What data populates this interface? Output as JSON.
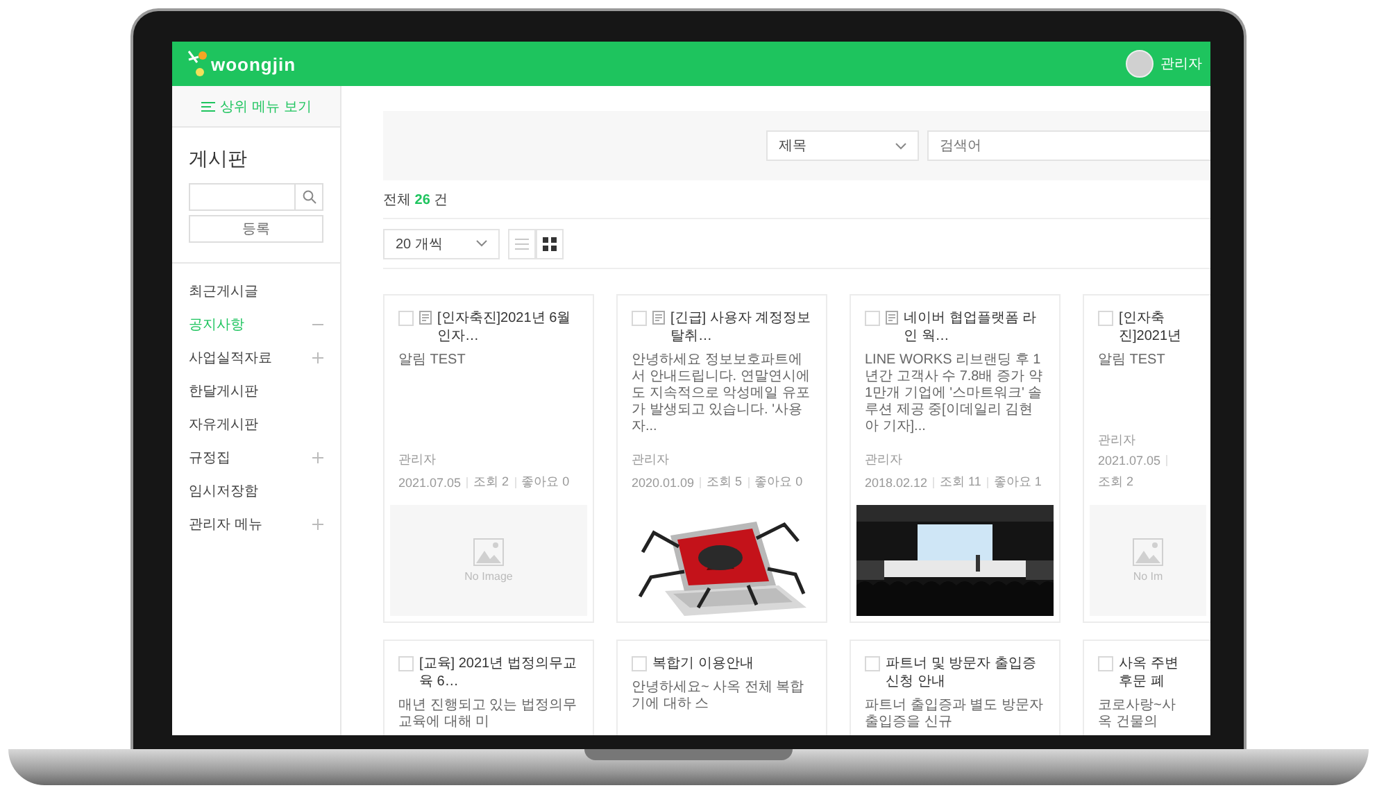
{
  "header": {
    "logo": "woongjin",
    "user": "관리자"
  },
  "sidebar": {
    "top_menu": "상위 메뉴 보기",
    "title": "게시판",
    "register": "등록",
    "items": [
      {
        "kind": "link",
        "label": "최근게시글",
        "selected": false
      },
      {
        "kind": "group",
        "label": "공지사항",
        "selected": true,
        "expanded": true
      },
      {
        "kind": "group",
        "label": "사업실적자료",
        "selected": false,
        "expanded": false
      },
      {
        "kind": "link",
        "label": "한달게시판",
        "selected": false
      },
      {
        "kind": "link",
        "label": "자유게시판",
        "selected": false
      },
      {
        "kind": "group",
        "label": "규정집",
        "selected": false,
        "expanded": false
      },
      {
        "kind": "link",
        "label": "임시저장함",
        "selected": false
      },
      {
        "kind": "group",
        "label": "관리자 메뉴",
        "selected": false,
        "expanded": false
      }
    ]
  },
  "search_panel": {
    "field": "제목",
    "placeholder": "검색어"
  },
  "total": {
    "prefix": "전체",
    "count": "26",
    "suffix": "건"
  },
  "toolbar": {
    "page_size": "20 개씩",
    "views": [
      {
        "kind": "list",
        "selected": false
      },
      {
        "kind": "grid",
        "selected": true
      }
    ]
  },
  "cards": [
    {
      "cut": false,
      "checked": false,
      "file": true,
      "title": "[인자축진]2021년 6월 인자…",
      "excerpt": "알림 TEST",
      "author": "관리자",
      "date": "2021.07.05",
      "views": "조회 2",
      "likes": "좋아요 0",
      "media": {
        "kind": "noimage",
        "label": "No Image"
      }
    },
    {
      "cut": false,
      "checked": false,
      "file": true,
      "title": "[긴급] 사용자 계정정보 탈취…",
      "excerpt": "안녕하세요 정보보호파트에서 안내드립니다. 연말연시에도 지속적으로 악성메일 유포가 발생되고 있습니다. '사용자...",
      "author": "관리자",
      "date": "2020.01.09",
      "views": "조회 5",
      "likes": "좋아요 0"
    },
    {
      "cut": false,
      "checked": false,
      "file": true,
      "title": "네이버 협업플랫폼 라인 웍…",
      "excerpt": "LINE WORKS 리브랜딩 후 1년간 고객사 수 7.8배 증가 약 1만개 기업에 '스마트워크' 솔루션 제공 중[이데일리 김현아 기자]...",
      "author": "관리자",
      "date": "2018.02.12",
      "views": "조회 11",
      "likes": "좋아요 1"
    },
    {
      "cut": true,
      "checked": false,
      "file": false,
      "title": "[인자축진]2021년",
      "excerpt": "알림 TEST",
      "author": "관리자",
      "date": "2021.07.05",
      "views": "조회 2",
      "media": {
        "kind": "noimage",
        "label": "No Im"
      }
    },
    {
      "cut": false,
      "checked": false,
      "file": false,
      "title": "[교육] 2021년 법정의무교육 6…",
      "excerpt": "매년 진행되고 있는 법정의무교육에 대해 미"
    },
    {
      "cut": false,
      "checked": false,
      "file": false,
      "title": "복합기 이용안내",
      "excerpt": "안녕하세요~ 사옥 전체 복합기에 대하 스"
    },
    {
      "cut": false,
      "checked": false,
      "file": false,
      "title": "파트너 및 방문자 출입증 신청 안내",
      "excerpt": "파트너 출입증과 별도 방문자 출입증을 신규"
    },
    {
      "cut": true,
      "checked": false,
      "file": false,
      "title": "사옥 주변 후문 폐",
      "excerpt": "코로사랑~사옥 건물의"
    }
  ]
}
